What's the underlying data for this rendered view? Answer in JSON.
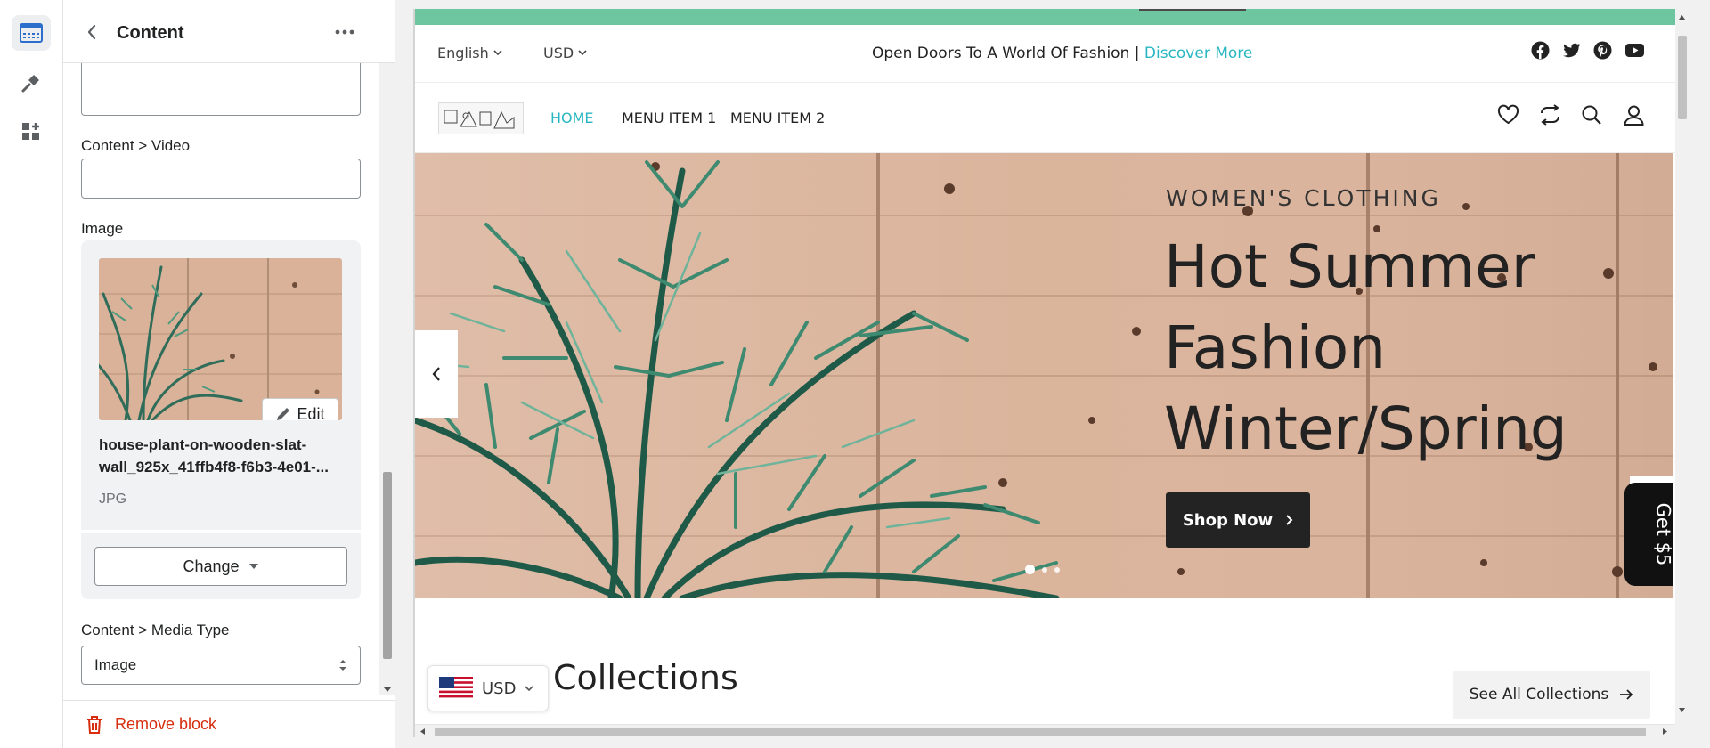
{
  "editor": {
    "panel": {
      "title": "Content",
      "fields": {
        "video_label": "Content > Video",
        "video_value": "",
        "image_label": "Image",
        "file_name_line1": "house-plant-on-wooden-slat-",
        "file_name_line2": "wall_925x_41ffb4f8-f6b3-4e01-...",
        "file_type": "JPG",
        "edit_label": "Edit",
        "change_label": "Change",
        "media_type_label": "Content > Media Type",
        "media_type_value": "Image"
      },
      "remove_label": "Remove block"
    },
    "rail_icons": [
      "sections-icon",
      "theme-settings-icon",
      "app-blocks-icon"
    ]
  },
  "preview": {
    "announcement": {
      "language": "English",
      "currency": "USD",
      "text": "Open Doors To A World Of Fashion |",
      "link": "Discover More"
    },
    "socials": [
      "facebook-icon",
      "twitter-icon",
      "pinterest-icon",
      "youtube-icon"
    ],
    "nav": {
      "items": [
        {
          "label": "HOME",
          "active": true
        },
        {
          "label": "MENU ITEM 1",
          "active": false
        },
        {
          "label": "MENU ITEM 2",
          "active": false
        }
      ]
    },
    "hero": {
      "subtitle": "WOMEN'S CLOTHING",
      "title_line1": "Hot Summer",
      "title_line2": "Fashion",
      "title_line3": "Winter/Spring",
      "button": "Shop Now",
      "slides": 3,
      "active_slide": 1
    },
    "promo_tab": "Get $5",
    "collections": {
      "title": "Collections",
      "see_all": "See All Collections"
    },
    "currency_selector": "USD"
  },
  "colors": {
    "accent_teal": "#28b7c2",
    "top_band": "#6ec6a0",
    "danger": "#d72c0d"
  }
}
